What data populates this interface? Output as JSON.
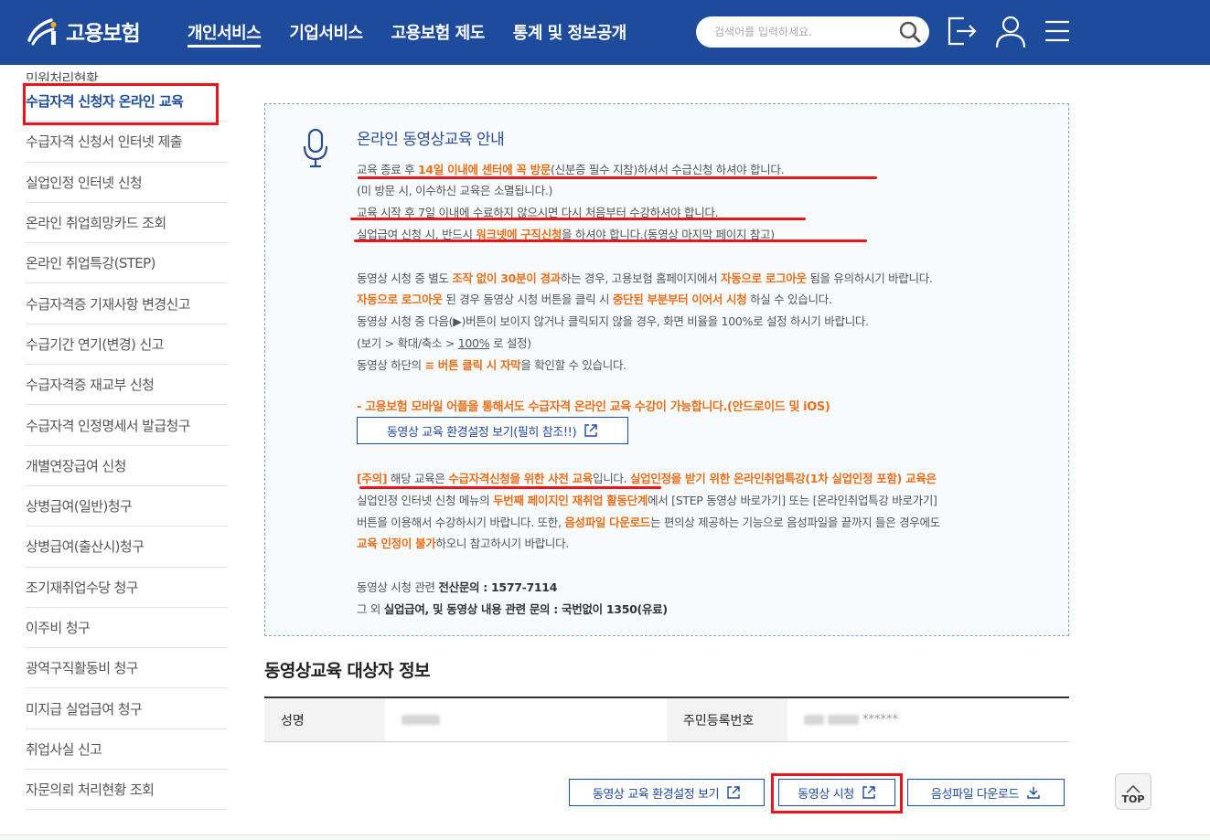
{
  "header": {
    "logo_text": "고용보험",
    "nav": [
      "개인서비스",
      "기업서비스",
      "고용보험 제도",
      "통계 및 정보공개"
    ],
    "search_placeholder": "검색어를 입력하세요."
  },
  "sidebar": {
    "items": [
      "민원처리현황",
      "수급자격 신청자 온라인 교육",
      "수급자격 신청서 인터넷 제출",
      "실업인정 인터넷 신청",
      "온라인 취업희망카드 조회",
      "온라인 취업특강(STEP)",
      "수급자격증 기재사항 변경신고",
      "수급기간 연기(변경) 신고",
      "수급자격증 재교부 신청",
      "수급자격 인정명세서 발급청구",
      "개별연장급여 신청",
      "상병급여(일반)청구",
      "상병급여(출산시)청구",
      "조기재취업수당 청구",
      "이주비 청구",
      "광역구직활동비 청구",
      "미지급 실업급여 청구",
      "취업사실 신고",
      "자문의뢰 처리현황 조회"
    ]
  },
  "info": {
    "title": "온라인 동영상교육 안내",
    "l1": [
      "교육 종료 후 ",
      "14일 이내에 센터에 꼭 방문",
      "(신분증 필수 지참)하셔서 수급신청 하셔야 합니다."
    ],
    "l2": "(미 방문 시, 이수하신 교육은 소멸됩니다.)",
    "l3": [
      "교육 시작 후 ",
      "7일 이내에 수료하지 않으시면 다시 처음부터 수강하셔야 합니다."
    ],
    "l4": [
      "실업급여 신청 시, 반드시 ",
      "워크넷에 구직신청",
      "을 하셔야 합니다.(동영상 마지막 페이지 참고)"
    ],
    "p1": [
      "동영상 시청 중 별도 ",
      "조작 없이 30분이 경과",
      "하는 경우, 고용보험 홈페이지에서 ",
      "자동으로 로그아웃",
      " 됨을 유의하시기 바랍니다."
    ],
    "p2": [
      "자동으로 로그아웃",
      " 된 경우 동영상 시청 버튼을 클릭 시 ",
      "중단된 부분부터 이어서 시청",
      " 하실 수 있습니다."
    ],
    "p3": "동영상 시청 중 다음(▶)버튼이 보이지 않거나 클릭되지 않을 경우, 화면 비율을 100%로 설정 하시기 바랍니다.",
    "p4": [
      "(보기 > 확대/축소 > ",
      "100%",
      " 로 설정)"
    ],
    "p5": [
      "동영상 하단의 ",
      "≡ 버튼 클릭 시 자막",
      "을 확인할 수 있습니다."
    ],
    "mobile": "- 고용보험 모바일 어플을 통해서도 수급자격 온라인 교육 수강이 가능합니다.(안드로이드 및 iOS)",
    "env_button": "동영상 교육 환경설정 보기(필히 참조!!)",
    "n1": [
      "[주의]",
      " 해당 교육은 ",
      "수급자격신청을 위한 사전 교육",
      "입니다. ",
      "실업인정을 받기 위한 온라인취업특강(1차 실업인정 포함) 교육은"
    ],
    "n2": [
      "실업인정 인터넷 신청 메뉴의 ",
      "두번째 페이지인 재취업 활동단계",
      "에서 [STEP 동영상 바로가기] 또는 [온라인취업특강 바로가기]"
    ],
    "n3": [
      "버튼을 이용해서 수강하시기 바랍니다. 또한, ",
      "음성파일 다운로드",
      "는 편의상 제공하는 기능으로 음성파일을 끝까지 들은 경우에도"
    ],
    "n4": [
      "교육 인정이 불가",
      "하오니 참고하시기 바랍니다."
    ],
    "c1": [
      "동영상 시청 관련 ",
      "전산문의 : 1577-7114"
    ],
    "c2": [
      "그 외 ",
      "실업급여, 및 동영상 내용 관련 문의 : 국번없이 1350(유료)"
    ]
  },
  "target": {
    "title": "동영상교육 대상자 정보",
    "name_label": "성명",
    "rrn_label": "주민등록번호",
    "rrn_mask": "******"
  },
  "actions": {
    "env": "동영상 교육 환경설정 보기",
    "watch": "동영상 시청",
    "download": "음성파일 다운로드",
    "top": "TOP"
  },
  "colors": {
    "header": "#1e4b9c",
    "accent": "#e8701a",
    "highlight": "#e8141e"
  }
}
